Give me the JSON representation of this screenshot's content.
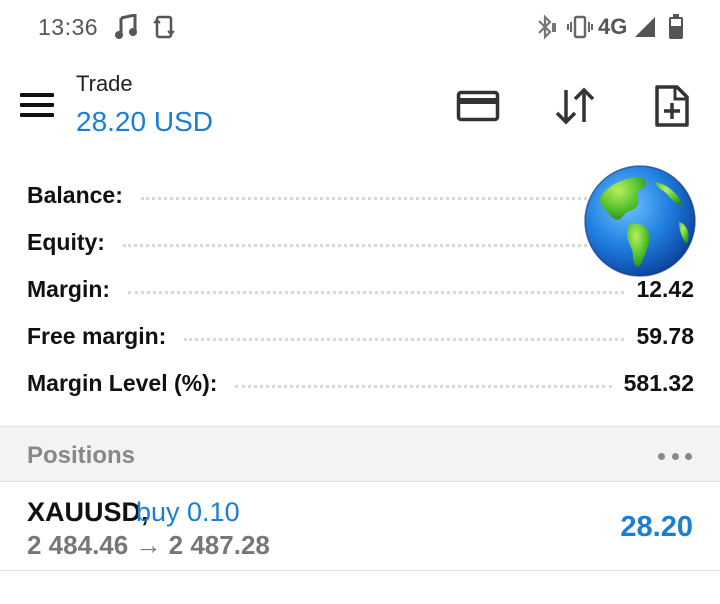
{
  "status_bar": {
    "time": "13:36",
    "network": "4G",
    "icons": [
      "music-icon",
      "screen-rotate-icon",
      "bluetooth-icon",
      "vibrate-icon",
      "signal-icon",
      "battery-icon"
    ]
  },
  "header": {
    "title": "Trade",
    "balance_display": "28.20 USD",
    "actions": [
      "card-icon",
      "sort-arrows-icon",
      "new-order-icon"
    ]
  },
  "account": {
    "rows": [
      {
        "label": "Balance:",
        "value": ""
      },
      {
        "label": "Equity:",
        "value": ""
      },
      {
        "label": "Margin:",
        "value": "12.42"
      },
      {
        "label": "Free margin:",
        "value": "59.78"
      },
      {
        "label": "Margin Level (%):",
        "value": "581.32"
      }
    ]
  },
  "positions": {
    "title": "Positions",
    "items": [
      {
        "symbol": "XAUUSD,",
        "side": "buy 0.10",
        "prices": "2 484.46 → 2 487.28",
        "profit": "28.20"
      }
    ]
  },
  "colors": {
    "accent": "#1a7dd6",
    "section_bg": "#f3f3f3",
    "muted_text": "#888888"
  }
}
